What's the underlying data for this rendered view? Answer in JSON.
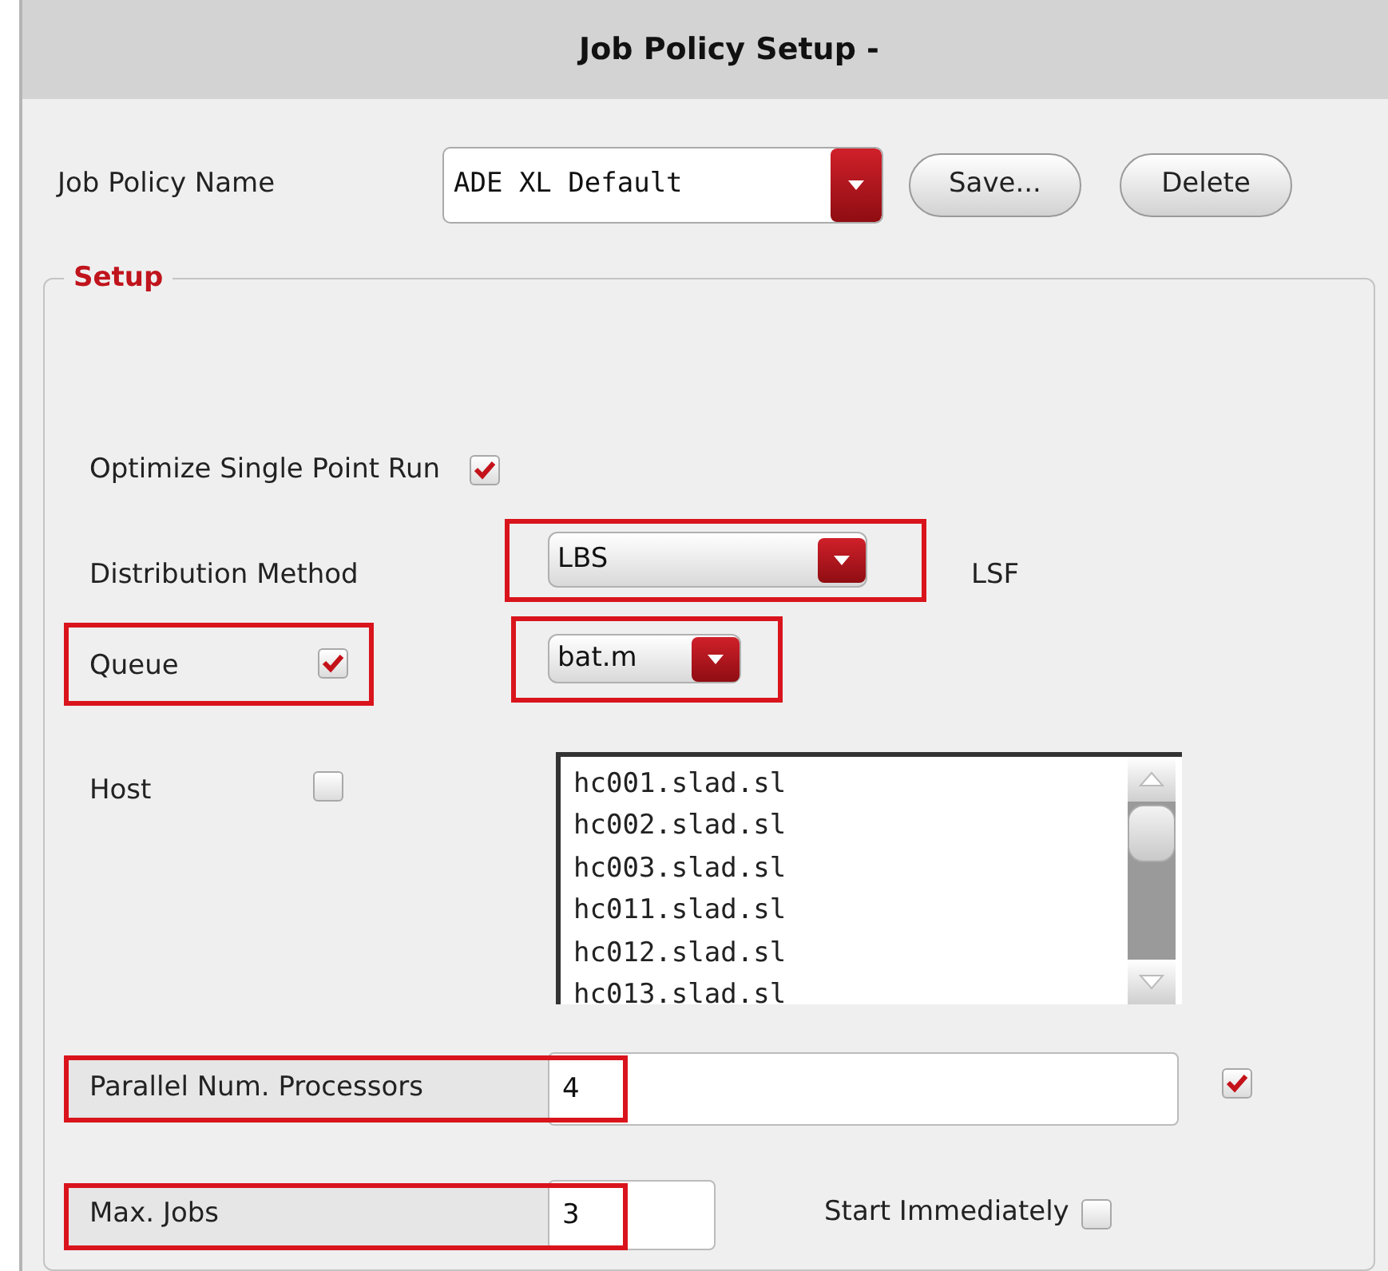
{
  "window": {
    "title": "Job Policy Setup -"
  },
  "policy": {
    "label": "Job Policy Name",
    "value": "ADE XL Default",
    "buttons": [
      "Save...",
      "Delete"
    ]
  },
  "setup": {
    "legend": "Setup",
    "optimize": {
      "label": "Optimize Single Point Run",
      "checked": true
    },
    "distribution": {
      "label": "Distribution Method",
      "value": "LBS",
      "note": "LSF",
      "highlighted": true
    },
    "queue": {
      "label": "Queue",
      "checked": true,
      "highlighted": true,
      "value": "bat.m",
      "value_highlighted": true
    },
    "host": {
      "label": "Host",
      "checked": false,
      "hosts": [
        "hc001.slad.sl",
        "hc002.slad.sl",
        "hc003.slad.sl",
        "hc011.slad.sl",
        "hc012.slad.sl",
        "hc013.slad.sl"
      ]
    },
    "parallel": {
      "label": "Parallel Num. Processors",
      "value": "4",
      "highlighted": true,
      "checked": true
    },
    "max_jobs": {
      "label": "Max. Jobs",
      "value": "3",
      "highlighted": true
    },
    "start": {
      "label": "Start Immediately",
      "checked": false
    }
  }
}
